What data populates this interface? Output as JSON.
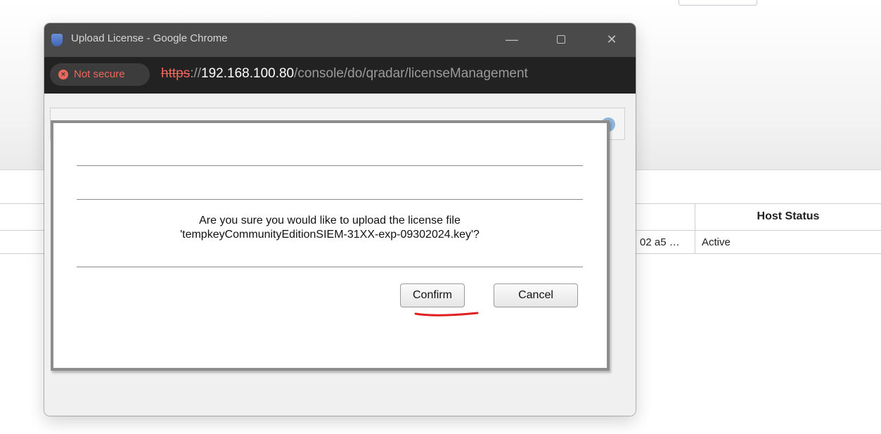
{
  "background_page": {
    "table": {
      "headers": [
        "",
        "Host Status"
      ],
      "rows": [
        {
          "truncated_value": "02 a5 …",
          "host_status": "Active"
        }
      ]
    }
  },
  "window": {
    "title": "Upload License - Google Chrome",
    "controls": {
      "minimize": "—",
      "maximize": "",
      "close": "✕"
    },
    "address_bar": {
      "security_badge": "Not secure",
      "url_scheme": "https",
      "url_separator": "://",
      "url_host": "192.168.100.80",
      "url_path": "/console/do/qradar/licenseManagement"
    }
  },
  "dialog": {
    "message_line1": "Are you sure you would like to upload the license file",
    "message_line2": "'tempkeyCommunityEditionSIEM-31XX-exp-09302024.key'?",
    "confirm_label": "Confirm",
    "cancel_label": "Cancel"
  },
  "colors": {
    "insecure_red": "#ee675c",
    "annotation_red": "#e02020",
    "titlebar": "#4a4a4a",
    "addressbar": "#222222"
  }
}
